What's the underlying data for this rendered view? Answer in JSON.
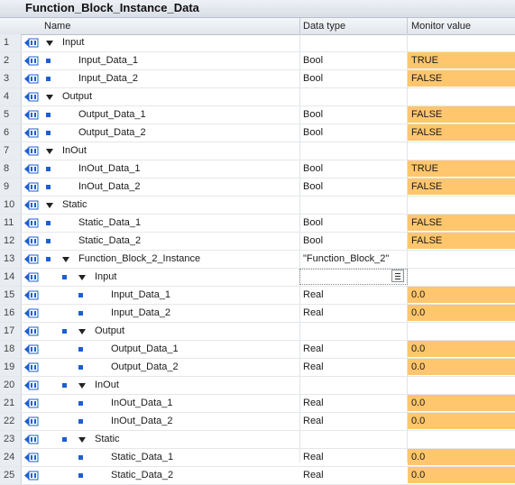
{
  "title": "Function_Block_Instance_Data",
  "columns": {
    "name": "Name",
    "data_type": "Data type",
    "monitor_value": "Monitor value"
  },
  "colors": {
    "monitor_highlight": "#ffc66e",
    "accent": "#1d5fd1"
  },
  "rows": [
    {
      "num": "1",
      "level": 0,
      "kind": "group",
      "name": "Input",
      "type": "",
      "value": ""
    },
    {
      "num": "2",
      "level": 0,
      "kind": "leaf",
      "name": "Input_Data_1",
      "type": "Bool",
      "value": "TRUE"
    },
    {
      "num": "3",
      "level": 0,
      "kind": "leaf",
      "name": "Input_Data_2",
      "type": "Bool",
      "value": "FALSE"
    },
    {
      "num": "4",
      "level": 0,
      "kind": "group",
      "name": "Output",
      "type": "",
      "value": ""
    },
    {
      "num": "5",
      "level": 0,
      "kind": "leaf",
      "name": "Output_Data_1",
      "type": "Bool",
      "value": "FALSE"
    },
    {
      "num": "6",
      "level": 0,
      "kind": "leaf",
      "name": "Output_Data_2",
      "type": "Bool",
      "value": "FALSE"
    },
    {
      "num": "7",
      "level": 0,
      "kind": "group",
      "name": "InOut",
      "type": "",
      "value": ""
    },
    {
      "num": "8",
      "level": 0,
      "kind": "leaf",
      "name": "InOut_Data_1",
      "type": "Bool",
      "value": "TRUE"
    },
    {
      "num": "9",
      "level": 0,
      "kind": "leaf",
      "name": "InOut_Data_2",
      "type": "Bool",
      "value": "FALSE"
    },
    {
      "num": "10",
      "level": 0,
      "kind": "group",
      "name": "Static",
      "type": "",
      "value": ""
    },
    {
      "num": "11",
      "level": 0,
      "kind": "leaf",
      "name": "Static_Data_1",
      "type": "Bool",
      "value": "FALSE"
    },
    {
      "num": "12",
      "level": 0,
      "kind": "leaf",
      "name": "Static_Data_2",
      "type": "Bool",
      "value": "FALSE"
    },
    {
      "num": "13",
      "level": 0,
      "kind": "subgroup",
      "name": "Function_Block_2_Instance",
      "type": "\"Function_Block_2\"",
      "value": ""
    },
    {
      "num": "14",
      "level": 1,
      "kind": "subgroup",
      "name": "Input",
      "type": "",
      "value": "",
      "selected": true
    },
    {
      "num": "15",
      "level": 1,
      "kind": "leaf",
      "name": "Input_Data_1",
      "type": "Real",
      "value": "0.0"
    },
    {
      "num": "16",
      "level": 1,
      "kind": "leaf",
      "name": "Input_Data_2",
      "type": "Real",
      "value": "0.0"
    },
    {
      "num": "17",
      "level": 1,
      "kind": "subgroup",
      "name": "Output",
      "type": "",
      "value": ""
    },
    {
      "num": "18",
      "level": 1,
      "kind": "leaf",
      "name": "Output_Data_1",
      "type": "Real",
      "value": "0.0"
    },
    {
      "num": "19",
      "level": 1,
      "kind": "leaf",
      "name": "Output_Data_2",
      "type": "Real",
      "value": "0.0"
    },
    {
      "num": "20",
      "level": 1,
      "kind": "subgroup",
      "name": "InOut",
      "type": "",
      "value": ""
    },
    {
      "num": "21",
      "level": 1,
      "kind": "leaf",
      "name": "InOut_Data_1",
      "type": "Real",
      "value": "0.0"
    },
    {
      "num": "22",
      "level": 1,
      "kind": "leaf",
      "name": "InOut_Data_2",
      "type": "Real",
      "value": "0.0"
    },
    {
      "num": "23",
      "level": 1,
      "kind": "subgroup",
      "name": "Static",
      "type": "",
      "value": ""
    },
    {
      "num": "24",
      "level": 1,
      "kind": "leaf",
      "name": "Static_Data_1",
      "type": "Real",
      "value": "0.0"
    },
    {
      "num": "25",
      "level": 1,
      "kind": "leaf",
      "name": "Static_Data_2",
      "type": "Real",
      "value": "0.0"
    }
  ]
}
